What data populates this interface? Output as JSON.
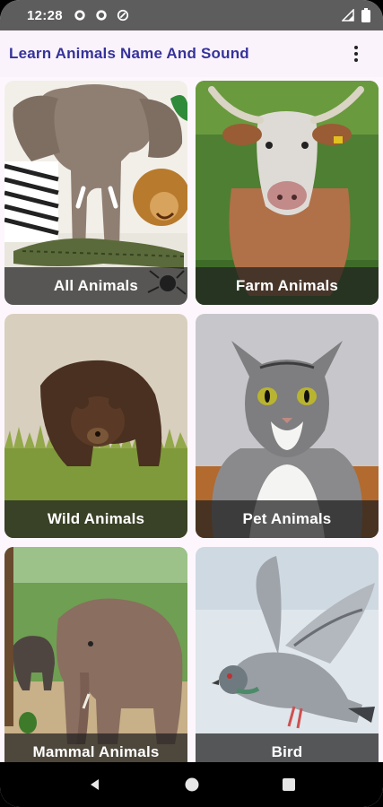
{
  "status_bar": {
    "time": "12:28",
    "icons": [
      "gear-icon",
      "gear-icon",
      "data-saver-icon"
    ],
    "right_icons": [
      "signal-icon",
      "battery-icon"
    ]
  },
  "app_bar": {
    "title": "Learn Animals Name And Sound",
    "menu_icon": "more-vert-icon"
  },
  "categories": [
    {
      "label": "All Animals"
    },
    {
      "label": "Farm Animals"
    },
    {
      "label": "Wild Animals"
    },
    {
      "label": "Pet Animals"
    },
    {
      "label": "Mammal Animals"
    },
    {
      "label": "Bird"
    }
  ],
  "nav_bar": {
    "icons": [
      "back-icon",
      "home-icon",
      "recents-icon"
    ]
  },
  "colors": {
    "title": "#35339a",
    "background": "#fdf7fd",
    "label_bar": "#1e1e1e"
  }
}
